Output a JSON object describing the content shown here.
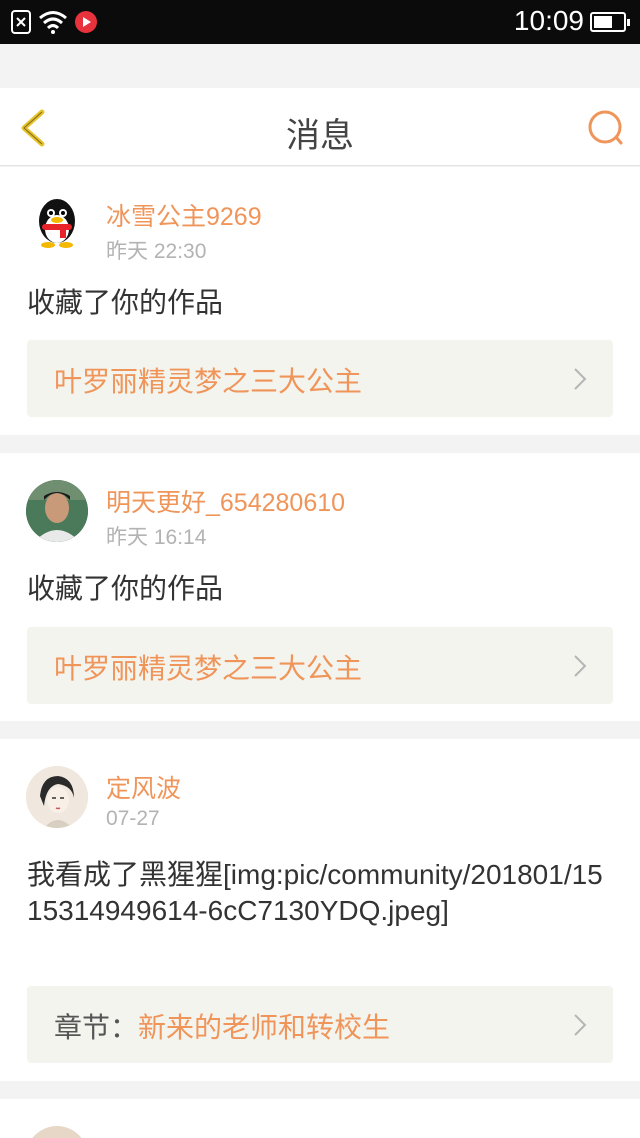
{
  "status_bar": {
    "time": "10:09"
  },
  "header": {
    "title": "消息"
  },
  "messages": [
    {
      "username": "冰雪公主9269",
      "time": "昨天 22:30",
      "action": "收藏了你的作品",
      "work_prefix": "",
      "work_title": "叶罗丽精灵梦之三大公主",
      "avatar": "qq-penguin-icon"
    },
    {
      "username": "明天更好_654280610",
      "time": "昨天 16:14",
      "action": "收藏了你的作品",
      "work_prefix": "",
      "work_title": "叶罗丽精灵梦之三大公主",
      "avatar": "user-photo"
    },
    {
      "username": "定风波",
      "time": "07-27",
      "action": "我看成了黑猩猩[img:pic/community/201801/1515314949614-6cC7130YDQ.jpeg]",
      "work_prefix": "章节：",
      "work_title": "新来的老师和转校生",
      "avatar": "illustration-avatar"
    }
  ],
  "colors": {
    "accent": "#f0955a",
    "back_icon": "#e8c22a",
    "status_bar": "#0b0b0b"
  }
}
